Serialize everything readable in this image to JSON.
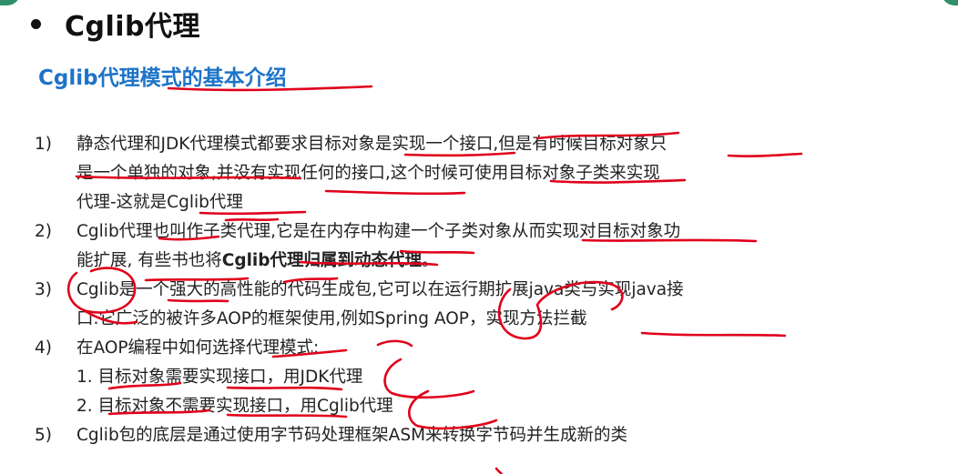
{
  "header": {
    "title": "Cglib代理"
  },
  "subtitle": "Cglib代理模式的基本介绍",
  "items": [
    {
      "num": "1)",
      "lines": [
        "静态代理和JDK代理模式都要求目标对象是实现一个接口,但是有时候目标对象只",
        "是一个单独的对象,并没有实现任何的接口,这个时候可使用目标对象子类来实现",
        "代理-这就是Cglib代理"
      ]
    },
    {
      "num": "2)",
      "line1": "Cglib代理也叫作子类代理,它是在内存中构建一个子类对象从而实现对目标对象功",
      "line2_prefix": "能扩展, 有些书也将",
      "line2_bold": "Cglib代理归属到动态代理",
      "line2_suffix": "。"
    },
    {
      "num": "3)",
      "lines": [
        "Cglib是一个强大的高性能的代码生成包,它可以在运行期扩展java类与实现java接",
        "口.它广泛的被许多AOP的框架使用,例如Spring AOP，实现方法拦截"
      ]
    },
    {
      "num": "4)",
      "lines": [
        "在AOP编程中如何选择代理模式:",
        "1. 目标对象需要实现接口，用JDK代理",
        "2. 目标对象不需要实现接口，用Cglib代理"
      ]
    },
    {
      "num": "5)",
      "lines": [
        "Cglib包的底层是通过使用字节码处理框架ASM来转换字节码并生成新的类"
      ]
    }
  ],
  "colors": {
    "title": "#111111",
    "subtitle": "#1e73c8",
    "body": "#222222",
    "annotation": "#e0001b"
  }
}
